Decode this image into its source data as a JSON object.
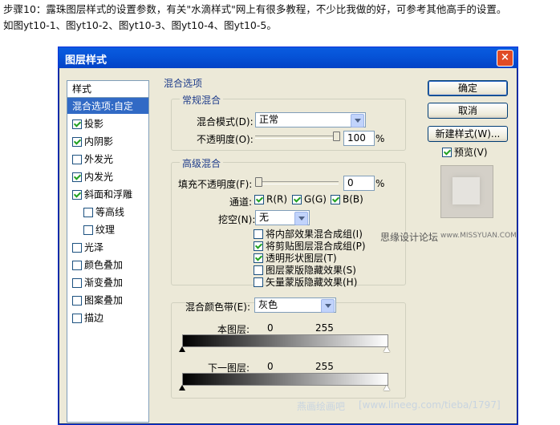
{
  "intro": {
    "line1": "步骤10：露珠图层样式的设置参数，有关\"水滴样式\"网上有很多教程，不少比我做的好，可参考其他高手的设置。",
    "line2": "如图yt10-1、图yt10-2、图yt10-3、图yt10-4、图yt10-5。"
  },
  "dialog": {
    "title": "图层样式",
    "close": "×"
  },
  "styles": {
    "header": "样式",
    "items": [
      {
        "label": "混合选项:自定",
        "checkable": false,
        "checked": false,
        "selected": true
      },
      {
        "label": "投影",
        "checkable": true,
        "checked": true
      },
      {
        "label": "内阴影",
        "checkable": true,
        "checked": true
      },
      {
        "label": "外发光",
        "checkable": true,
        "checked": false
      },
      {
        "label": "内发光",
        "checkable": true,
        "checked": true
      },
      {
        "label": "斜面和浮雕",
        "checkable": true,
        "checked": true
      },
      {
        "label": "等高线",
        "checkable": true,
        "checked": false,
        "indent": true
      },
      {
        "label": "纹理",
        "checkable": true,
        "checked": false,
        "indent": true
      },
      {
        "label": "光泽",
        "checkable": true,
        "checked": false
      },
      {
        "label": "颜色叠加",
        "checkable": true,
        "checked": false
      },
      {
        "label": "渐变叠加",
        "checkable": true,
        "checked": false
      },
      {
        "label": "图案叠加",
        "checkable": true,
        "checked": false
      },
      {
        "label": "描边",
        "checkable": true,
        "checked": false
      }
    ]
  },
  "blend_options": {
    "section": "混合选项",
    "general": {
      "title": "常规混合",
      "mode_label": "混合模式(D):",
      "mode_value": "正常",
      "opacity_label": "不透明度(O):",
      "opacity_value": "100",
      "opacity_fraction": 1.0,
      "percent": "%"
    },
    "advanced": {
      "title": "高级混合",
      "fill_label": "填充不透明度(F):",
      "fill_value": "0",
      "fill_fraction": 0.0,
      "percent": "%",
      "channels_label": "通道:",
      "channel_r": "R(R)",
      "channel_g": "G(G)",
      "channel_b": "B(B)",
      "knockout_label": "挖空(N):",
      "knockout_value": "无",
      "options": [
        {
          "label": "将内部效果混合成组(I)",
          "checked": false
        },
        {
          "label": "将剪贴图层混合成组(P)",
          "checked": true
        },
        {
          "label": "透明形状图层(T)",
          "checked": true
        },
        {
          "label": "图层蒙版隐藏效果(S)",
          "checked": false
        },
        {
          "label": "矢量蒙版隐藏效果(H)",
          "checked": false
        }
      ]
    },
    "blend_if": {
      "label": "混合颜色带(E):",
      "value": "灰色",
      "this_layer_label": "本图层:",
      "this_layer_min": "0",
      "this_layer_max": "255",
      "underlying_label": "下一图层:",
      "underlying_min": "0",
      "underlying_max": "255"
    }
  },
  "buttons": {
    "ok": "确定",
    "cancel": "取消",
    "new_style": "新建样式(W)...",
    "preview": "预览(V)"
  },
  "watermarks": {
    "site": "思缘设计论坛",
    "url": "www.MISSYUAN.COM",
    "footer": "[www.lineeg.com/tieba/1797]",
    "footer_brand": "燕画绘画吧"
  }
}
